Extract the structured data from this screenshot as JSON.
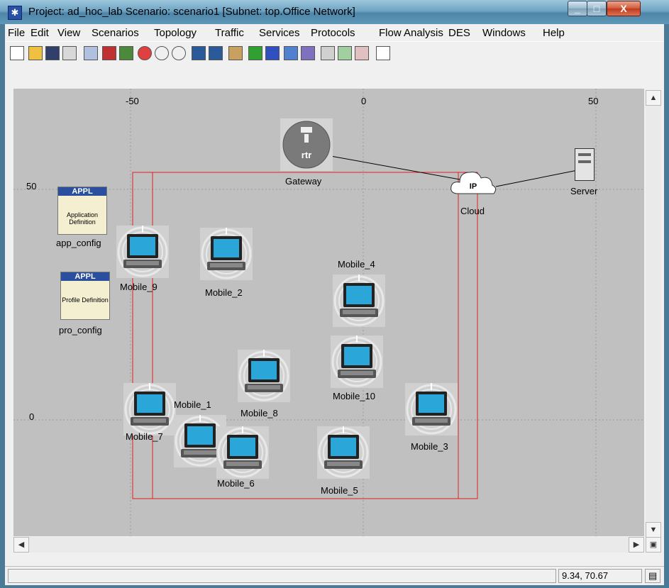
{
  "window": {
    "title": "Project: ad_hoc_lab Scenario: scenario1  [Subnet: top.Office Network]"
  },
  "menu": [
    "File",
    "Edit",
    "View",
    "Scenarios",
    "Topology",
    "Traffic",
    "Services",
    "Protocols",
    "Flow Analysis",
    "DES",
    "Windows",
    "Help"
  ],
  "axes": {
    "x_ticks": [
      "-50",
      "0",
      "50"
    ],
    "y_ticks": [
      "50",
      "0"
    ]
  },
  "nodes": {
    "gateway": {
      "label": "Gateway",
      "icon_text": "rtr"
    },
    "cloud": {
      "label": "Cloud",
      "icon_text": "IP"
    },
    "server": {
      "label": "Server"
    },
    "app_config": {
      "label": "app_config",
      "badge": "APPL",
      "caption": "Application Definition"
    },
    "pro_config": {
      "label": "pro_config",
      "badge": "APPL",
      "caption": "Profile Definition"
    },
    "mobiles": [
      {
        "label": "Mobile_9"
      },
      {
        "label": "Mobile_2"
      },
      {
        "label": "Mobile_4"
      },
      {
        "label": "Mobile_10"
      },
      {
        "label": "Mobile_8"
      },
      {
        "label": "Mobile_7"
      },
      {
        "label": "Mobile_1"
      },
      {
        "label": "Mobile_6"
      },
      {
        "label": "Mobile_5"
      },
      {
        "label": "Mobile_3"
      }
    ]
  },
  "status": {
    "coords": "9.34, 70.67"
  },
  "colors": {
    "canvas_bg": "#c0c0c0",
    "region_border": "#e02020",
    "link_color": "#000000"
  }
}
